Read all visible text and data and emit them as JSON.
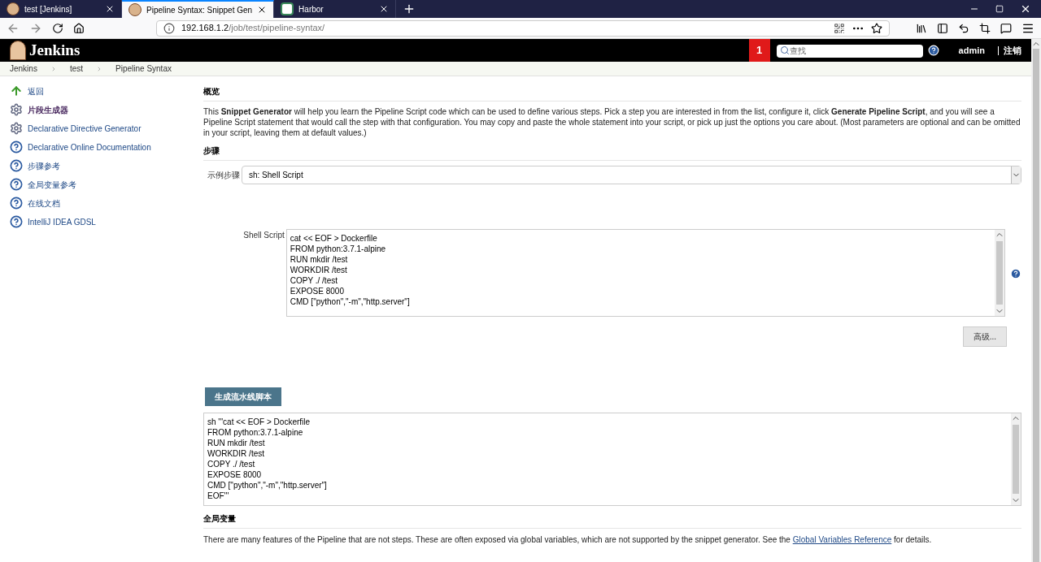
{
  "browser": {
    "tabs": [
      {
        "label": "test [Jenkins]",
        "selected": false,
        "kind": "jenkins"
      },
      {
        "label": "Pipeline Syntax: Snippet Gen",
        "selected": true,
        "kind": "jenkins"
      },
      {
        "label": "Harbor",
        "selected": false,
        "kind": "harbor"
      }
    ],
    "url_host": "192.168.1.2",
    "url_path": "/job/test/pipeline-syntax/"
  },
  "header": {
    "logo": "Jenkins",
    "notification_count": "1",
    "search": {
      "placeholder": "查找"
    },
    "user": "admin",
    "logout": "注销"
  },
  "breadcrumbs": [
    "Jenkins",
    "test",
    "Pipeline Syntax"
  ],
  "sidebar": {
    "items": [
      {
        "label": "返回",
        "kind": "back",
        "selected": false
      },
      {
        "label": "片段生成器",
        "kind": "gear",
        "selected": true
      },
      {
        "label": "Declarative Directive Generator",
        "kind": "gear",
        "selected": false
      },
      {
        "label": "Declarative Online Documentation",
        "kind": "help",
        "selected": false
      },
      {
        "label": "步骤参考",
        "kind": "help",
        "selected": false
      },
      {
        "label": "全局变量参考",
        "kind": "help",
        "selected": false
      },
      {
        "label": "在线文档",
        "kind": "help",
        "selected": false
      },
      {
        "label": "IntelliJ IDEA GDSL",
        "kind": "help",
        "selected": false
      }
    ]
  },
  "overview": {
    "heading": "概览",
    "text": "This **Snippet Generator** will help you learn the Pipeline Script code which can be used to define various steps. Pick a step you are interested in from the list, configure it, click **Generate Pipeline Script**, and you will see a Pipeline Script statement that would call the step with that configuration. You may copy and paste the whole statement into your script, or pick up just the options you care about. (Most parameters are optional and can be omitted in your script, leaving them at default values.)"
  },
  "steps": {
    "heading": "步骤",
    "sample_label": "示例步骤",
    "sample_value": "sh: Shell Script",
    "script_label": "Shell Script",
    "script_lines": [
      "cat << EOF > Dockerfile",
      "FROM python:3.7.1-alpine",
      "RUN mkdir /test",
      "WORKDIR /test",
      "COPY ./ /test",
      "EXPOSE 8000",
      "CMD [\"python\",\"-m\",\"http.server\"]"
    ],
    "advanced_button": "高级...",
    "generate_button": "生成流水线脚本",
    "output_lines": [
      "sh '''cat << EOF > Dockerfile",
      "FROM python:3.7.1-alpine",
      "RUN mkdir /test",
      "WORKDIR /test",
      "COPY ./ /test",
      "EXPOSE 8000",
      "CMD [\"python\",\"-m\",\"http.server\"]",
      "EOF'''"
    ]
  },
  "globals": {
    "heading": "全局变量",
    "text": "There are many features of the Pipeline that are not steps. These are often exposed via global variables, which are not supported by the snippet generator. See the",
    "link": "Global Variables Reference",
    "text_after": "for details."
  }
}
